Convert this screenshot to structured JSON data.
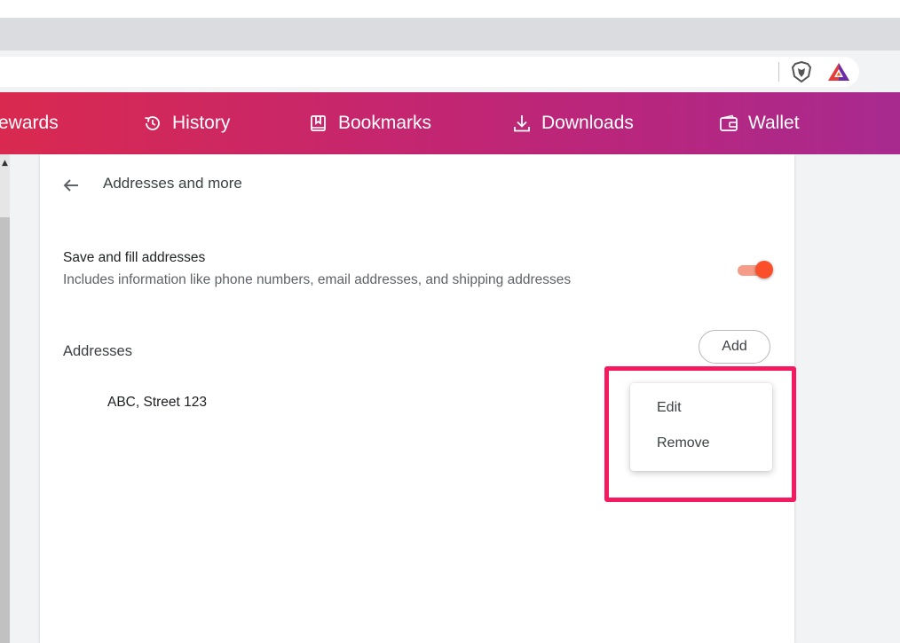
{
  "browser": {
    "toolbar_icons": [
      "brave-shield-icon",
      "bat-rewards-icon"
    ]
  },
  "navbar": {
    "items": [
      {
        "label": "ewards",
        "icon": "rewards-icon"
      },
      {
        "label": "History",
        "icon": "history-icon"
      },
      {
        "label": "Bookmarks",
        "icon": "bookmarks-icon"
      },
      {
        "label": "Downloads",
        "icon": "downloads-icon"
      },
      {
        "label": "Wallet",
        "icon": "wallet-icon"
      }
    ]
  },
  "page": {
    "title": "Addresses and more",
    "save_setting": {
      "label": "Save and fill addresses",
      "description": "Includes information like phone numbers, email addresses, and shipping addresses",
      "enabled": true
    },
    "addresses": {
      "heading": "Addresses",
      "add_label": "Add",
      "items": [
        "ABC, Street 123"
      ]
    }
  },
  "context_menu": {
    "items": [
      "Edit",
      "Remove"
    ]
  },
  "colors": {
    "gradient_start": "#d9294f",
    "gradient_end": "#a82a8f",
    "toggle_on": "#fa4f2a",
    "highlight": "#f5195f"
  }
}
